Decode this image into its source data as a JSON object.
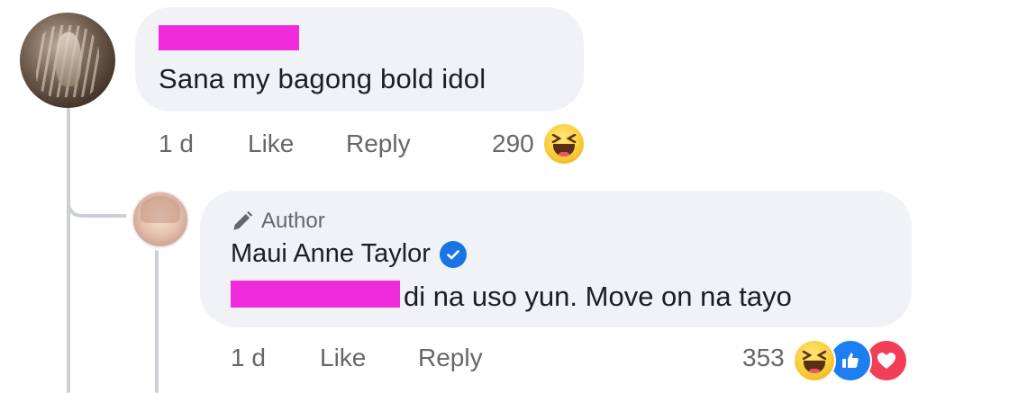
{
  "comment": {
    "text": "Sana my bagong bold idol",
    "time": "1 d",
    "like_label": "Like",
    "reply_label": "Reply",
    "reaction_count": "290",
    "reactions": [
      "haha-reaction-icon"
    ]
  },
  "reply": {
    "badge": "Author",
    "author_name": "Maui Anne Taylor",
    "text": "di na uso yun. Move on na tayo",
    "time": "1 d",
    "like_label": "Like",
    "reply_label": "Reply",
    "reaction_count": "353",
    "reactions": [
      "haha-reaction-icon",
      "like-reaction-icon",
      "love-reaction-icon"
    ]
  },
  "colors": {
    "bubble": "#f0f2f5",
    "meta_text": "#65676b",
    "verified_blue": "#1b74e4",
    "redaction": "#f02bdc"
  }
}
